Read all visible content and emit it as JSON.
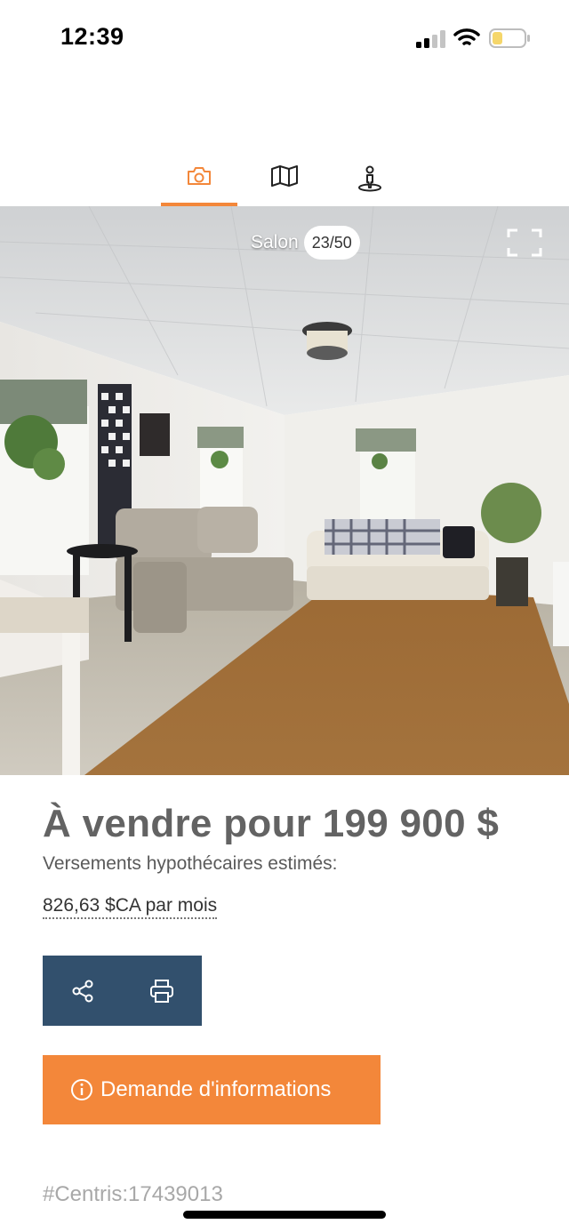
{
  "status_bar": {
    "time": "12:39",
    "icons": [
      "cellular-signal-icon",
      "wifi-icon",
      "battery-low-icon"
    ],
    "battery_color": "#f5d66a"
  },
  "tabs": [
    {
      "icon": "camera-icon",
      "active": true
    },
    {
      "icon": "map-icon",
      "active": false
    },
    {
      "icon": "street-view-icon",
      "active": false
    }
  ],
  "photo": {
    "room_label": "Salon",
    "counter": "23/50",
    "fullscreen_icon": "fullscreen-icon"
  },
  "listing": {
    "price_line": "À vendre pour 199 900 $",
    "mortgage_label": "Versements hypothécaires estimés:",
    "mortgage_value": "826,63 $CA par mois",
    "centris_id": "#Centris:17439013"
  },
  "actions": {
    "share_icon": "share-icon",
    "print_icon": "print-icon",
    "info_button_label": "Demande d'informations",
    "info_icon": "info-icon"
  },
  "colors": {
    "accent": "#f3873a",
    "action_bar": "#32506d",
    "price_text": "#636363",
    "centris_text": "#a8a8a8"
  }
}
